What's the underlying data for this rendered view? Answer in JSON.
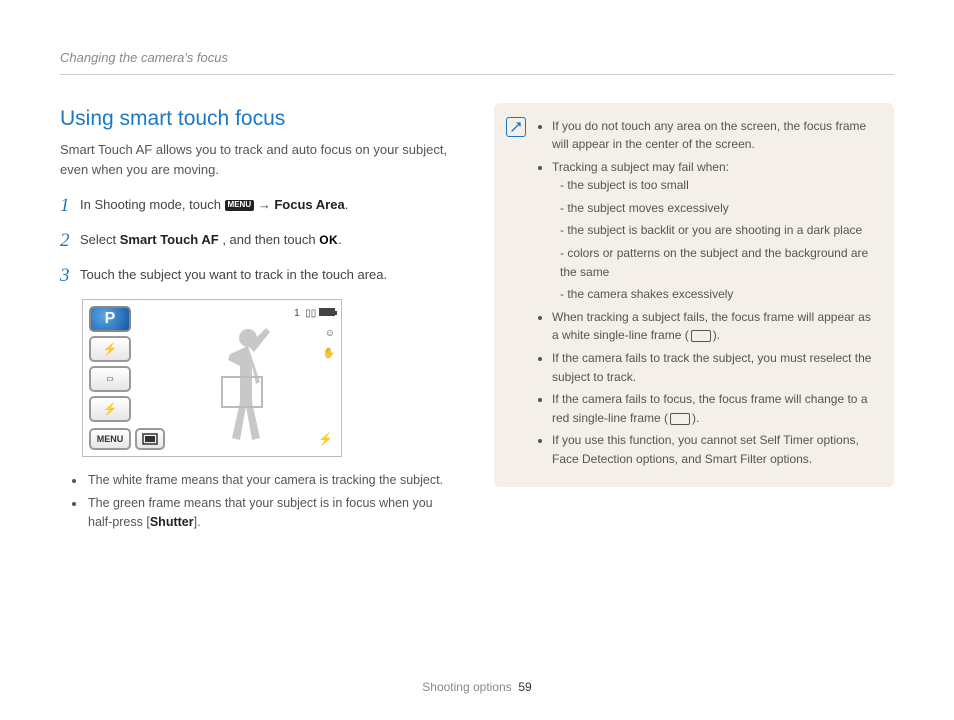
{
  "header": {
    "chapter": "Changing the camera's focus"
  },
  "section": {
    "title": "Using smart touch focus",
    "intro": "Smart Touch AF allows you to track and auto focus on your subject, even when you are moving."
  },
  "steps": {
    "s1_a": "In Shooting mode, touch ",
    "s1_menu": "MENU",
    "s1_arrow": " → ",
    "s1_b": "Focus Area",
    "s2_a": "Select ",
    "s2_bold": "Smart Touch AF",
    "s2_b": ", and then touch ",
    "s2_ok": "OK",
    "s3": "Touch the subject you want to track in the touch area."
  },
  "stepnums": {
    "n1": "1",
    "n2": "2",
    "n3": "3"
  },
  "screenshot": {
    "p": "P",
    "menu": "MENU",
    "count": "1"
  },
  "subnotes": {
    "a": "The white frame means that your camera is tracking the subject.",
    "b_a": "The green frame means that your subject is in focus when you half-press [",
    "b_bold": "Shutter",
    "b_b": "]."
  },
  "info": {
    "i1": "If you do not touch any area on the screen, the focus frame will appear in the center of the screen.",
    "i2": "Tracking a subject may fail when:",
    "i2a": "the subject is too small",
    "i2b": "the subject moves excessively",
    "i2c": "the subject is backlit or you are shooting in a dark place",
    "i2d": "colors or patterns on the subject and the background are the same",
    "i2e": "the camera shakes excessively",
    "i3_a": "When tracking a subject fails, the focus frame will appear as a white single-line frame (",
    "i3_b": ").",
    "i4": "If the camera fails to track the subject, you must reselect the subject to track.",
    "i5_a": "If the camera fails to focus, the focus frame will change to a red single-line frame (",
    "i5_b": ").",
    "i6": "If you use this function, you cannot set Self Timer options, Face Detection options, and Smart Filter options."
  },
  "footer": {
    "label": "Shooting options",
    "page": "59"
  }
}
